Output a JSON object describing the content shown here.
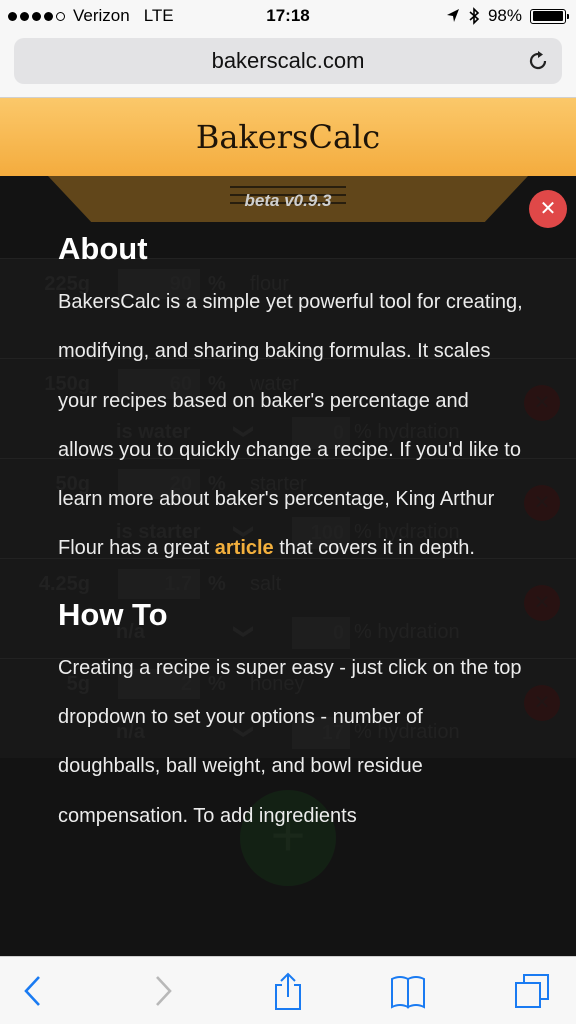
{
  "status_bar": {
    "carrier": "Verizon",
    "network": "LTE",
    "time": "17:18",
    "battery": "98%",
    "battery_level": 0.98
  },
  "browser": {
    "url": "bakerscalc.com"
  },
  "app": {
    "brand": "BakersCalc",
    "version": "beta v0.9.3"
  },
  "background_rows": [
    {
      "weight": "225g",
      "percent": "90",
      "pct_sign": "%",
      "name": "flour",
      "sub": "",
      "hydration": "",
      "hyd_label": ""
    },
    {
      "weight": "150g",
      "percent": "60",
      "pct_sign": "%",
      "name": "water",
      "sub": "is water",
      "hydration": "0",
      "hyd_label": "% hydration"
    },
    {
      "weight": "50g",
      "percent": "20",
      "pct_sign": "%",
      "name": "starter",
      "sub": "is starter",
      "hydration": "100",
      "hyd_label": "% hydration"
    },
    {
      "weight": "4.25g",
      "percent": "1.7",
      "pct_sign": "%",
      "name": "salt",
      "sub": "n/a",
      "hydration": "0",
      "hyd_label": "% hydration"
    },
    {
      "weight": "5g",
      "percent": "2",
      "pct_sign": "%",
      "name": "honey",
      "sub": "n/a",
      "hydration": "17",
      "hyd_label": "% hydration"
    }
  ],
  "modal": {
    "about_title": "About",
    "about_text_1": "BakersCalc is a simple yet powerful tool for creating, modifying, and sharing baking formulas. It scales your recipes based on baker's percentage and allows you to quickly change a recipe. If you'd like to learn more about baker's percentage, King Arthur Flour has a great ",
    "about_link": "article",
    "about_text_2": " that covers it in depth.",
    "howto_title": "How To",
    "howto_text": "Creating a recipe is super easy - just click on the top dropdown to set your options - number of doughballs, ball weight, and bowl residue compensation. To add ingredients"
  },
  "colors": {
    "accent": "#f3b03d",
    "close": "#e04848",
    "header": "#f4ac3e"
  },
  "icons": {
    "close": "close-icon",
    "back": "back-icon",
    "forward": "forward-icon",
    "share": "share-icon",
    "bookmarks": "bookmarks-icon",
    "tabs": "tabs-icon",
    "reload": "reload-icon"
  }
}
